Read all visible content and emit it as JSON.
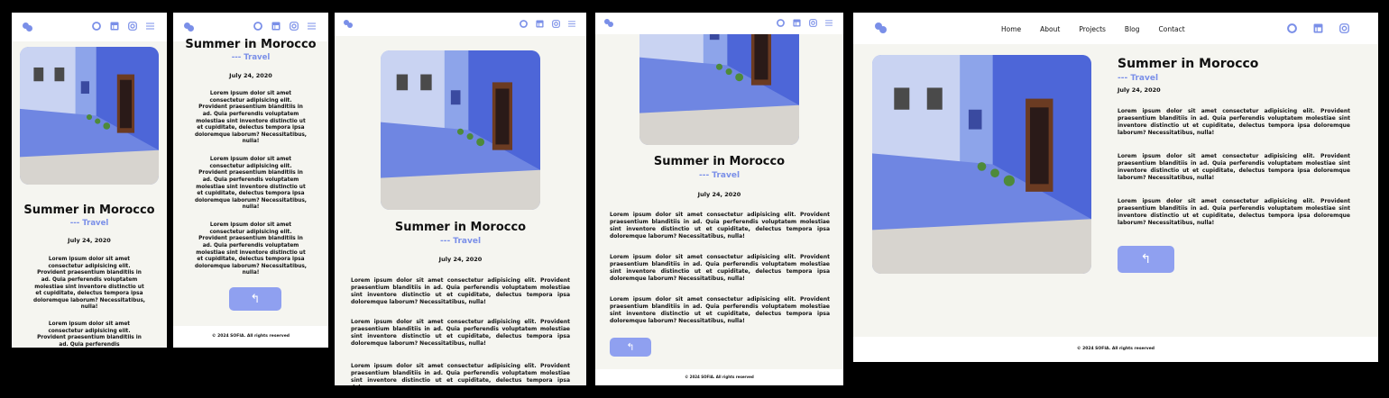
{
  "site": {
    "logo_icon": "logo-icon",
    "nav": [
      "Home",
      "About",
      "Projects",
      "Blog",
      "Contact"
    ]
  },
  "social": {
    "github_icon": "github-icon",
    "linkedin_icon": "linkedin-icon",
    "instagram_icon": "instagram-icon",
    "menu_icon": "menu-icon"
  },
  "post": {
    "title": "Summer in Morocco",
    "category": "--- Travel",
    "date": "July 24, 2020",
    "paragraph": "Lorem ipsum dolor sit amet consectetur adipisicing elit. Provident praesentium blanditiis in ad. Quia perferendis voluptatem molestiae sint inventore distinctio ut et cupiditate, delectus tempora ipsa doloremque laborum? Necessitatibus, nulla!",
    "paragraph_cut": "Lorem ipsum dolor sit amet consectetur adipisicing elit. Provident praesentium blanditiis in ad. Quia perferendis",
    "paragraph_cut_wide": "Lorem ipsum dolor sit amet consectetur adipisicing elit. Provident praesentium blanditiis in ad. Quia perferendis voluptatem molestiae sint inventore distinctio ut et cupiditate, delectus tempora ipsa doloremque",
    "back_icon": "back-arrow-icon",
    "back_glyph": "↰"
  },
  "footer": {
    "text": "© 2024 SOFIA. All rights reserved"
  },
  "colors": {
    "accent": "#7a8fe8",
    "button": "#8fa0f0",
    "background": "#f5f5f0",
    "nav": "#ffffff"
  }
}
